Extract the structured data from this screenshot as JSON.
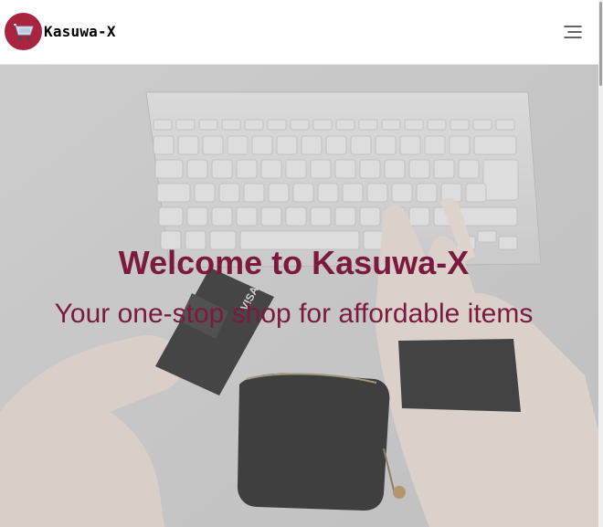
{
  "navbar": {
    "brand_name": "Kasuwa-X",
    "logo_icon": "shopping-cart-icon",
    "menu_icon": "hamburger-menu-icon"
  },
  "hero": {
    "title": "Welcome to Kasuwa-X",
    "subtitle": "Your one-stop shop for affordable items",
    "background_image": "hands-with-keyboard-card-and-wallet-photo"
  },
  "colors": {
    "brand_accent": "#a8243f",
    "hero_text": "#7b1a3e",
    "navbar_background": "#ffffff",
    "hero_overlay": "#bdbdbd"
  }
}
